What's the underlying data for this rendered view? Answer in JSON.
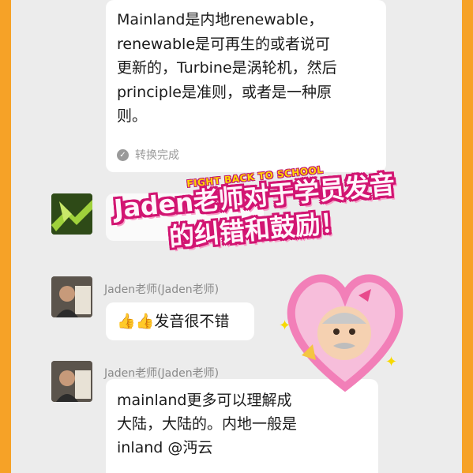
{
  "messages": [
    {
      "text_lines": [
        "Mainland是内地renewable，",
        "renewable是可再生的或者说可",
        "更新的，Turbine是涡轮机，然后",
        "principle是准则，或者是一种原",
        "则。"
      ],
      "status": "转换完成"
    },
    {
      "sender": "Jaden老师(Jaden老师)",
      "text": "👍👍发音很不错"
    },
    {
      "sender": "Jaden老师(Jaden老师)",
      "text_lines": [
        "mainland更多可以理解成",
        "大陆，大陆的。内地一般是",
        "inland @沔云"
      ]
    }
  ],
  "banner": {
    "small": "FIGHT BACK TO SCHOOL",
    "line1": "Jaden老师对于学员发音",
    "line2": "的纠错和鼓励！"
  },
  "colors": {
    "frame": "#f6a227",
    "chat_bg": "#ececec",
    "banner_outline": "#d21572",
    "heart": "#f27fb8"
  },
  "icons": [
    "check-circle-icon",
    "thumbs-up-icon",
    "heart-sticker-icon",
    "sparkle-icon"
  ]
}
